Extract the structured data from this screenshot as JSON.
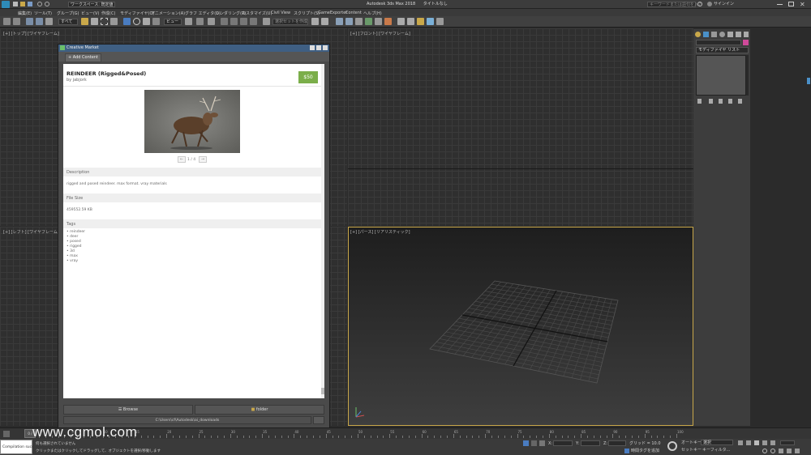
{
  "app": {
    "title": "Autodesk 3ds Max 2018",
    "title_suffix": "タイトルなし",
    "workspace": "ワークスペース: 既定値",
    "search_placeholder": "キーワードまたは語句を入力",
    "signin": "サインイン"
  },
  "menubar": {
    "items": [
      "編集(E)",
      "ツール(T)",
      "グループ(G)",
      "ビュー(V)",
      "作成(C)",
      "モディファイヤ(O)",
      "アニメーション(A)",
      "グラフ エディタ(D)",
      "レンダリング(R)",
      "カスタマイズ(U)",
      "Civil View",
      "スクリプト(S)",
      "GameExporter",
      "Content",
      "ヘルプ(H)"
    ]
  },
  "toolbar": {
    "selection_filter": "すべて",
    "view_dropdown": "ビュー",
    "selection_set": "選択セットを作成"
  },
  "viewports": {
    "top": "[+] [トップ] [ワイヤフレーム]",
    "front": "[+] [フロント] [ワイヤフレーム]",
    "left": "[+] [レフト] [ワイヤフレーム]",
    "perspective": "[+] [パース] [リアリスティック]"
  },
  "dialog": {
    "title": "Creative Market",
    "add_content": "+ Add Content",
    "product_title": "REINDEER (Rigged&Posed)",
    "author": "by jabjork",
    "price": "$50",
    "pager": "1 / 4",
    "description_head": "Description",
    "description": "rigged and posed reindeer. max format. vray materials",
    "filesize_head": "File Size",
    "filesize": "459552.59 KB",
    "tags_head": "Tags",
    "tags": [
      "reindeer",
      "deer",
      "posed",
      "rigged",
      "3d",
      "max",
      "vray"
    ],
    "browse_btn": "Browse",
    "folder_btn": "folder",
    "path": "C:\\Users\\cf\\Autodesk\\ai_downloads"
  },
  "cmdpanel": {
    "modifier_list": "モディファイヤ リスト"
  },
  "timeline": {
    "ticks": [
      "0",
      "5",
      "10",
      "15",
      "20",
      "25",
      "30",
      "35",
      "40",
      "45",
      "50",
      "55",
      "60",
      "65",
      "70",
      "75",
      "80",
      "85",
      "90",
      "95",
      "100"
    ],
    "frame": "0 / 100"
  },
  "statusbar": {
    "script_label": "Compilation succ",
    "status1": "何も選択されていません",
    "status2": "クリックまたはクリックしてドラッグして、オブジェクトを選択/移動します",
    "x_label": "X:",
    "y_label": "Y:",
    "z_label": "Z:",
    "grid": "グリッド = 10.0",
    "time_tag": "時間タグを追加",
    "auto_key": "オートキー",
    "selected": "選択",
    "set_key": "セットキー",
    "key_filters": "キーフィルタ..."
  },
  "watermark": "www.cgmol.com"
}
